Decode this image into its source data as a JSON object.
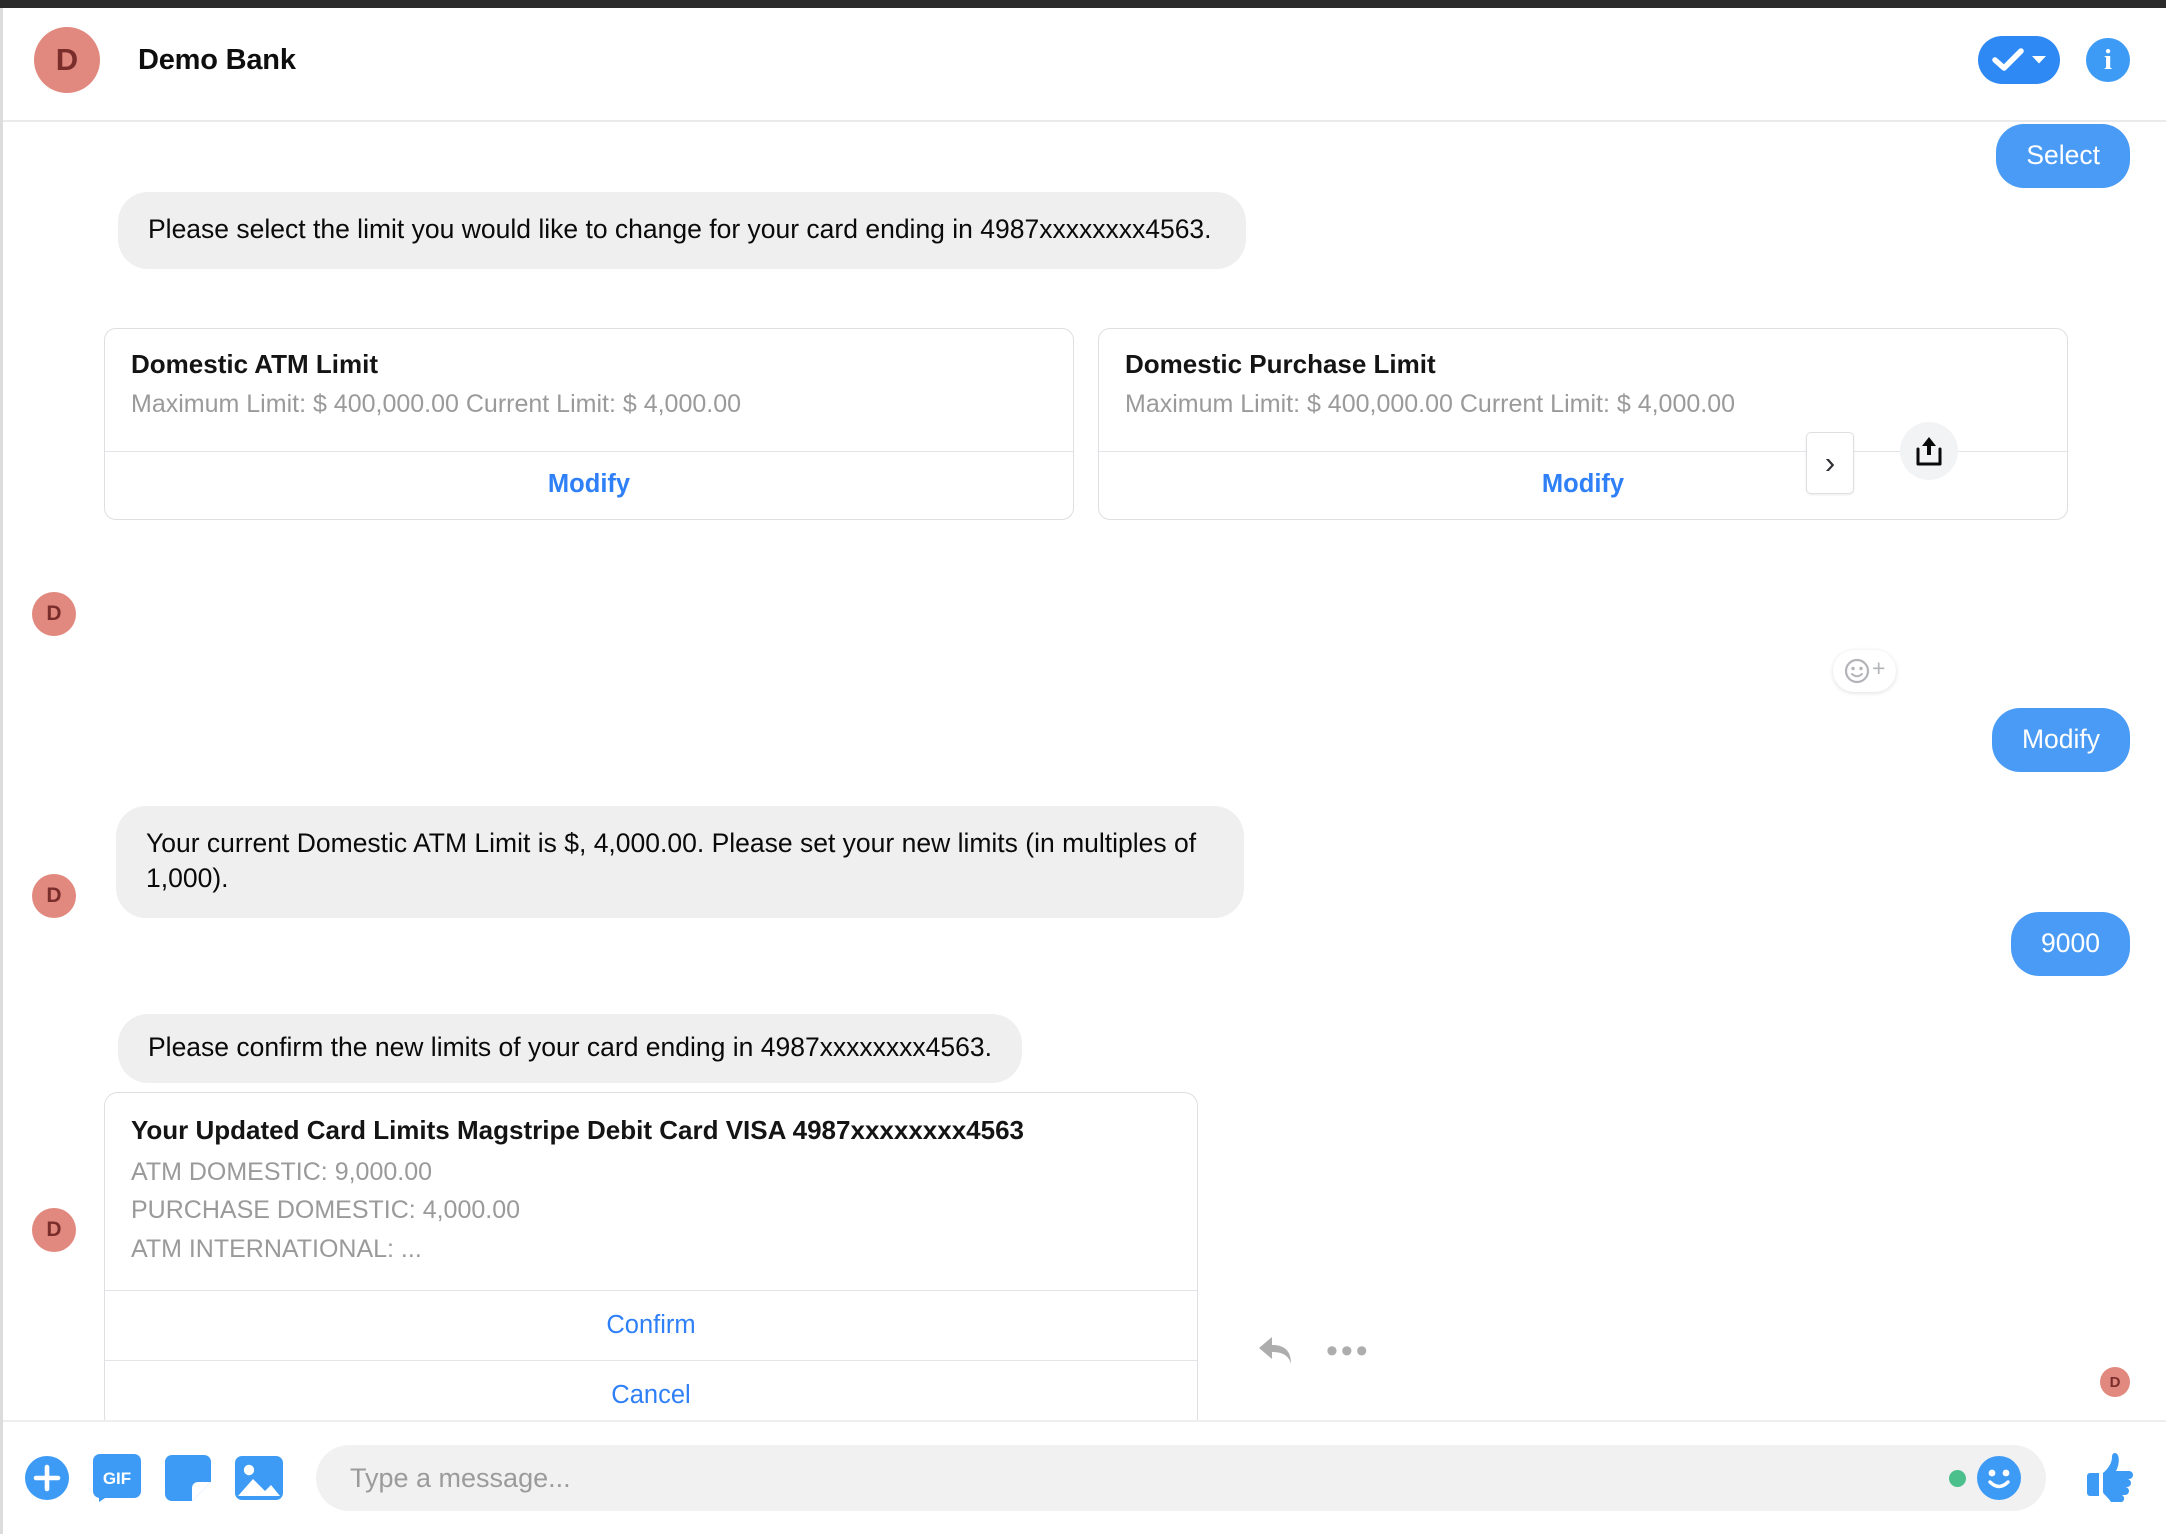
{
  "window": {
    "top_strip_color": "#2b2b2b"
  },
  "header": {
    "avatar_initial": "D",
    "title": "Demo Bank",
    "actions": {
      "check_label": "check-dropdown",
      "info_label": "i"
    }
  },
  "colors": {
    "accent_blue": "#2e89f5",
    "bubble_out": "#4a9bf5",
    "bubble_in": "#efefef",
    "link_blue": "#2f80f7",
    "avatar_bg": "#e2897f",
    "avatar_fg": "#7a2e2c",
    "online_dot": "#4cc08c"
  },
  "messages": {
    "select_reply": "Select",
    "prompt_select_limit": "Please select the limit you would like to change for your card ending in 4987xxxxxxxx4563.",
    "modify_reply": "Modify",
    "current_limit_prompt": "Your current Domestic ATM Limit is $, 4,000.00. Please set your new limits (in multiples of 1,000).",
    "amount_reply": "9000",
    "confirm_prompt": "Please confirm the new limits of your card ending in 4987xxxxxxxx4563."
  },
  "limit_cards": [
    {
      "title": "Domestic ATM Limit",
      "subtitle": "Maximum Limit: $ 400,000.00 Current Limit: $ 4,000.00",
      "action": "Modify"
    },
    {
      "title": "Domestic Purchase Limit",
      "subtitle": "Maximum Limit: $ 400,000.00 Current Limit: $ 4,000.00",
      "action": "Modify"
    }
  ],
  "carousel": {
    "next_glyph": "›"
  },
  "summary_card": {
    "title": "Your Updated Card Limits Magstripe Debit Card VISA 4987xxxxxxxx4563",
    "lines": [
      "ATM DOMESTIC: 9,000.00",
      "PURCHASE DOMESTIC: 4,000.00",
      "ATM INTERNATIONAL: ..."
    ],
    "confirm_label": "Confirm",
    "cancel_label": "Cancel"
  },
  "hover_actions": {
    "dots": "•••"
  },
  "seen": {
    "avatar_initial": "D"
  },
  "composer": {
    "placeholder": "Type a message...",
    "gif_label": "GIF"
  }
}
